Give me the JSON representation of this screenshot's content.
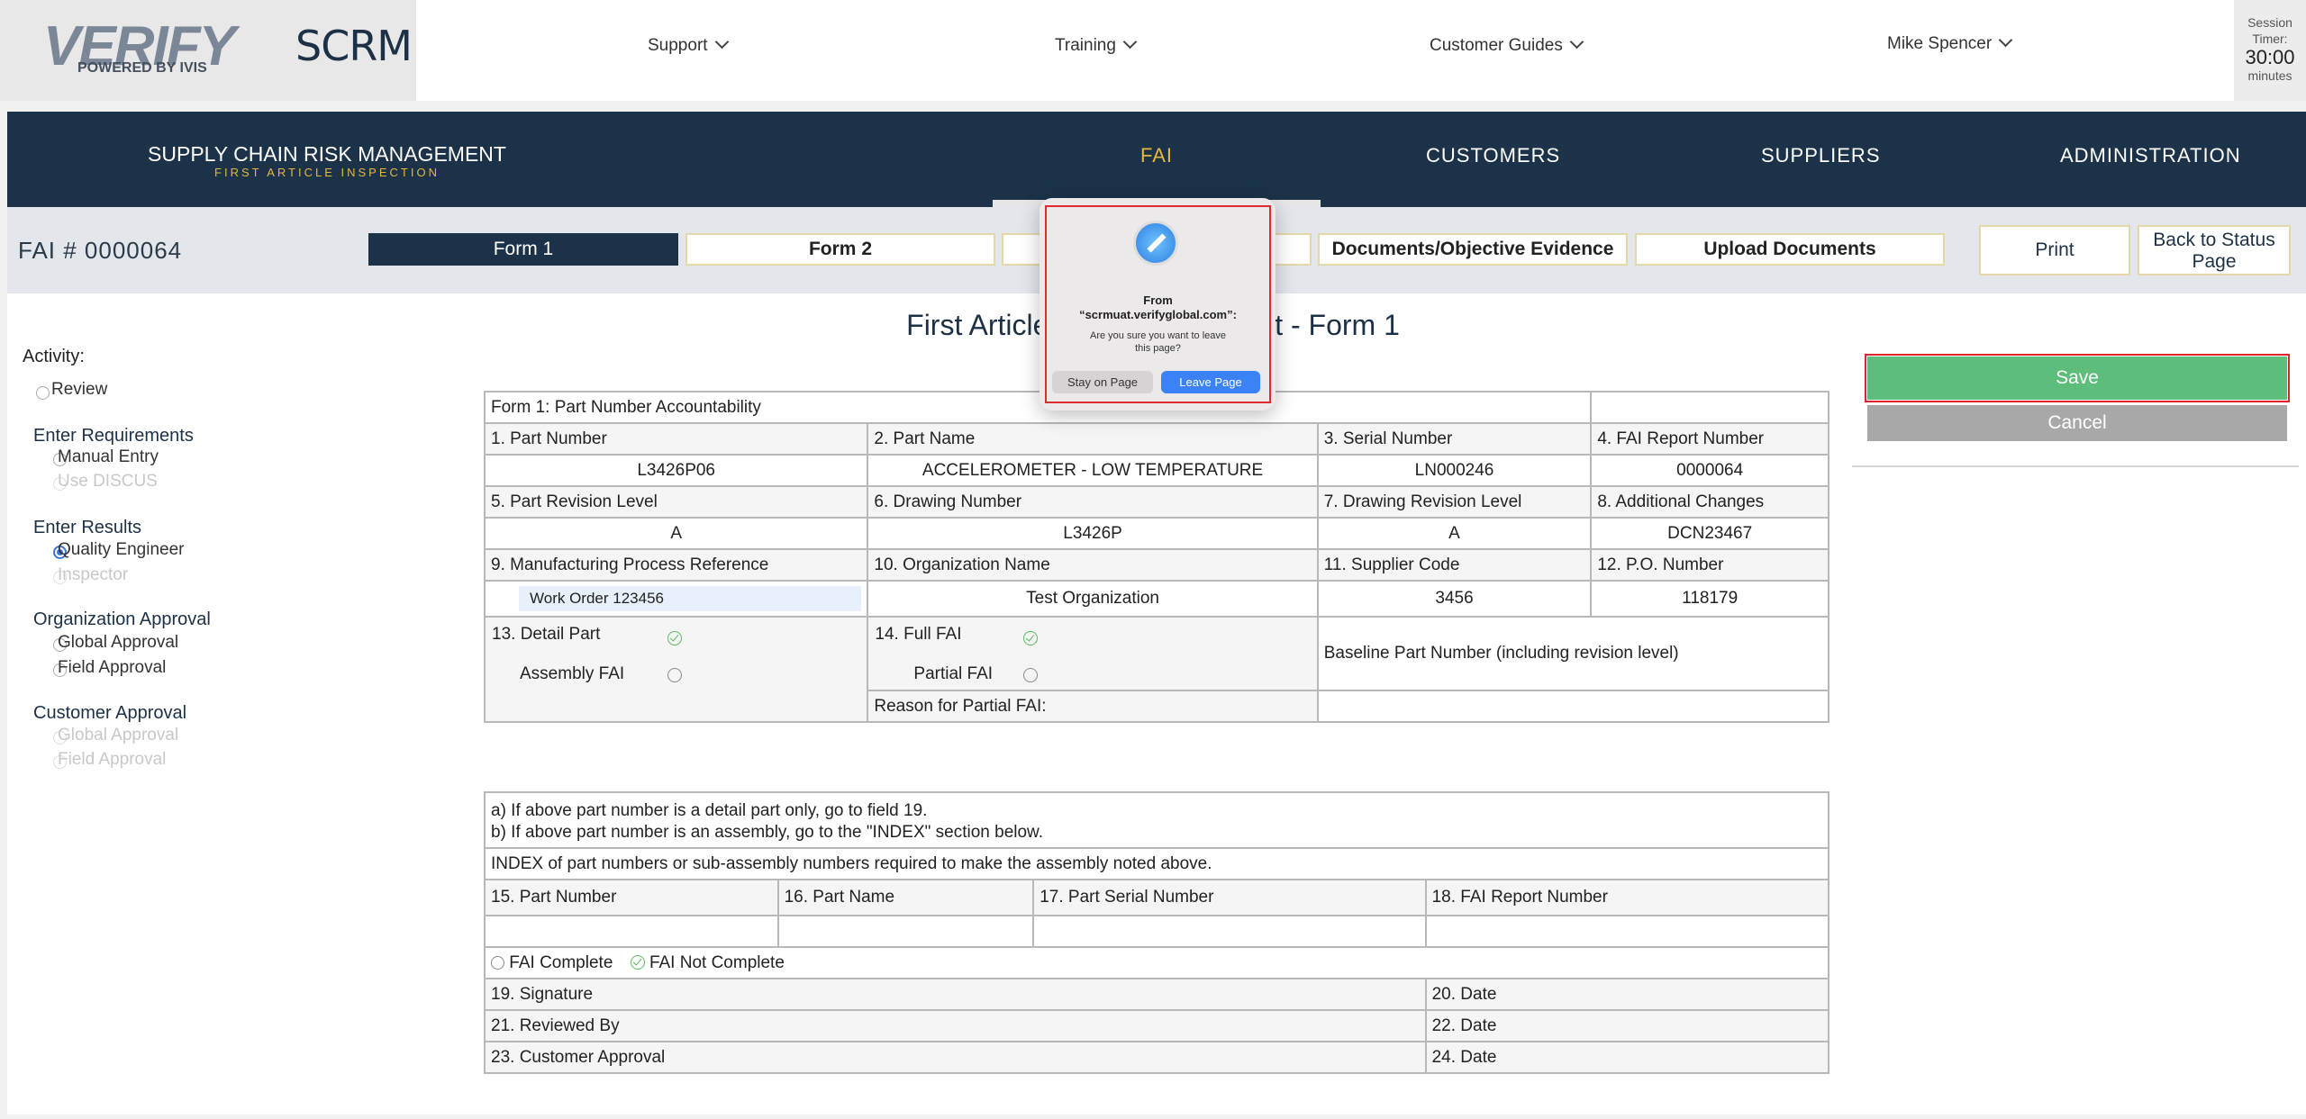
{
  "topbar": {
    "logo": "VERIFY",
    "logo_sub": "POWERED BY IVIS",
    "app_name": "SCRM",
    "nav": [
      "Support",
      "Training",
      "Customer Guides"
    ],
    "user": "Mike Spencer",
    "session_label_1": "Session",
    "session_label_2": "Timer:",
    "session_time": "30:00",
    "session_unit": "minutes"
  },
  "header": {
    "title": "SUPPLY CHAIN RISK MANAGEMENT",
    "subtitle": "FIRST ARTICLE INSPECTION",
    "nav": [
      "FAI",
      "CUSTOMERS",
      "SUPPLIERS",
      "ADMINISTRATION"
    ],
    "active_color": "#e6b63d"
  },
  "subheader": {
    "fai_number": "FAI # 0000064",
    "tabs": [
      "Form 1",
      "Form 2",
      "",
      "Documents/Objective Evidence",
      "Upload Documents"
    ],
    "print": "Print",
    "back_1": "Back to Status",
    "back_2": "Page"
  },
  "page_title": "First Article Inspection Report - Form 1",
  "sidebar": {
    "activity": "Activity:",
    "review": "Review",
    "groups": [
      {
        "label": "Enter Requirements",
        "options": [
          "Manual Entry",
          "Use DISCUS"
        ]
      },
      {
        "label": "Enter Results",
        "options": [
          "Quality Engineer",
          "Inspector"
        ]
      },
      {
        "label": "Organization Approval",
        "options": [
          "Global Approval",
          "Field Approval"
        ]
      },
      {
        "label": "Customer Approval",
        "options": [
          "Global Approval",
          "Field Approval"
        ]
      }
    ]
  },
  "form": {
    "section": "Form 1: Part Number Accountability",
    "h1": [
      "1. Part Number",
      "2. Part Name",
      "3. Serial Number",
      "4. FAI Report Number"
    ],
    "v1": [
      "L3426P06",
      "ACCELEROMETER - LOW TEMPERATURE",
      "LN000246",
      "0000064"
    ],
    "h2": [
      "5. Part Revision Level",
      "6. Drawing Number",
      "7. Drawing Revision Level",
      "8. Additional Changes"
    ],
    "v2": [
      "A",
      "L3426P",
      "A",
      "DCN23467"
    ],
    "h3": [
      "9. Manufacturing Process Reference",
      "10. Organization Name",
      "11. Supplier Code",
      "12. P.O. Number"
    ],
    "v3": [
      "Work Order 123456",
      "Test Organization",
      "3456",
      "118179"
    ],
    "detail_part": "13. Detail Part",
    "assembly_fai": "Assembly FAI",
    "full_fai": "14. Full FAI",
    "partial_fai": "Partial FAI",
    "baseline": "Baseline Part Number (including revision level)",
    "reason": "Reason for Partial FAI:"
  },
  "form2": {
    "note_a": "a) If above part number is a detail part only, go to field 19.",
    "note_b": "b) If above part number is an assembly, go to the \"INDEX\" section below.",
    "index": "INDEX of part numbers or sub-assembly numbers required to make the assembly noted above.",
    "cols": [
      "15. Part Number",
      "16. Part Name",
      "17. Part Serial Number",
      "18. FAI Report Number"
    ],
    "fai_complete": "FAI Complete",
    "fai_not_complete": "FAI Not Complete",
    "rows": [
      [
        "19. Signature",
        "20. Date"
      ],
      [
        "21. Reviewed By",
        "22. Date"
      ],
      [
        "23. Customer Approval",
        "24. Date"
      ]
    ]
  },
  "actions": {
    "save": "Save",
    "cancel": "Cancel"
  },
  "dialog": {
    "from": "From",
    "host": "“scrmuat.verifyglobal.com”:",
    "msg_1": "Are you sure you want to leave",
    "msg_2": "this page?",
    "stay": "Stay on Page",
    "leave": "Leave Page",
    "icon": "safari-icon"
  }
}
